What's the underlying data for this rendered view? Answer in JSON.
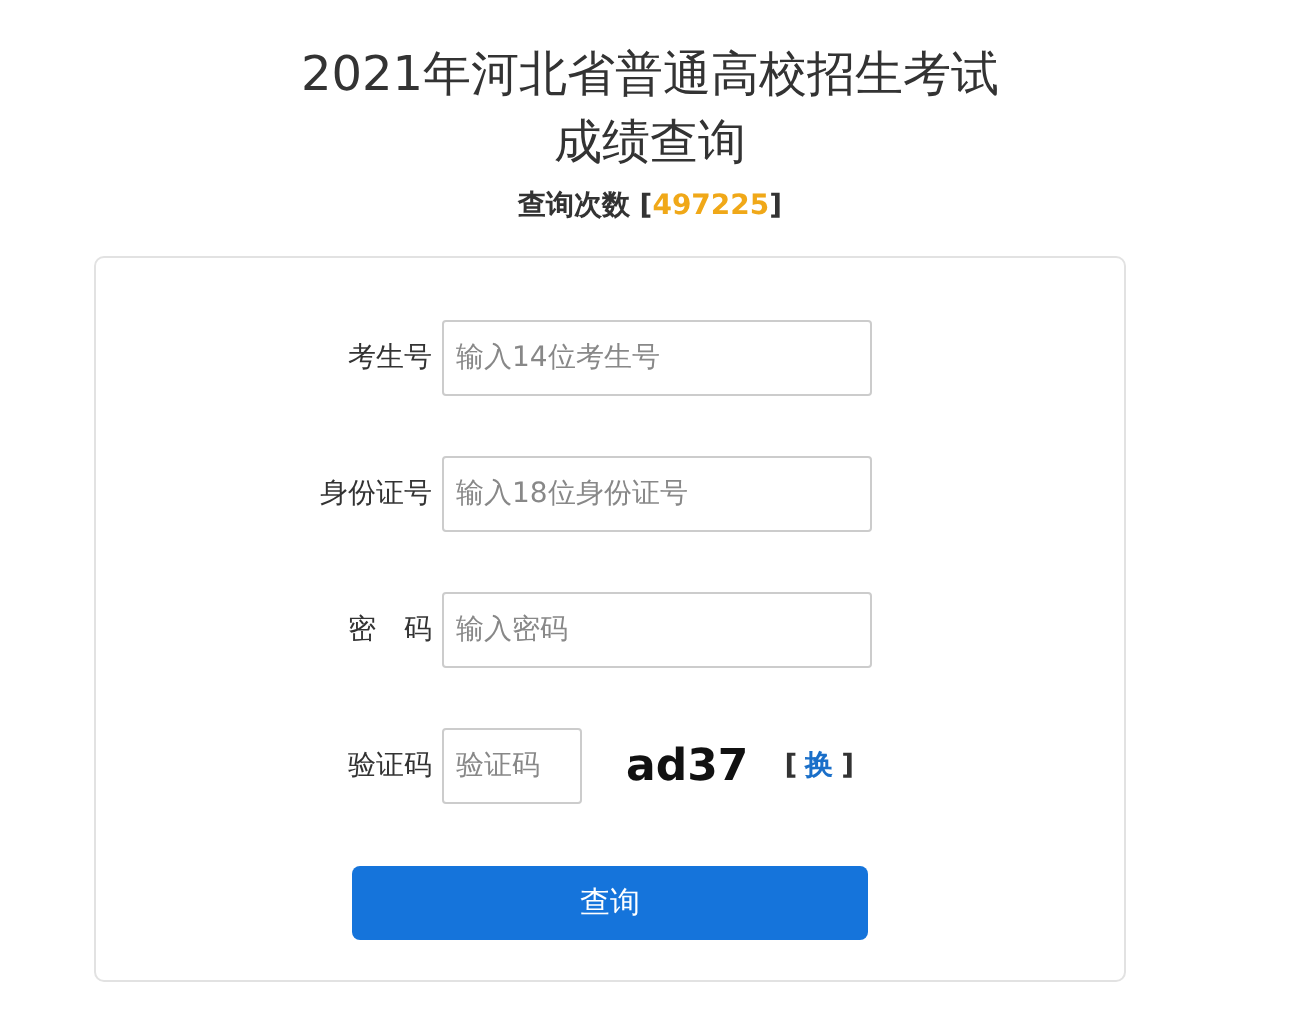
{
  "title": [
    "2021年河北省普通高校招生考试",
    "成绩查询"
  ],
  "counter": {
    "label": "查询次数 [",
    "count": "497225",
    "close": "]"
  },
  "fields": [
    {
      "label": "考生号",
      "placeholder": "输入14位考生号",
      "kind": "text"
    },
    {
      "label": "身份证号",
      "placeholder": "输入18位身份证号",
      "kind": "text"
    },
    {
      "label": "密　码",
      "placeholder": "输入密码",
      "kind": "password"
    },
    {
      "label": "验证码",
      "placeholder": "验证码",
      "kind": "captcha"
    }
  ],
  "captcha": {
    "code": "ad37",
    "open": "[",
    "refresh": "换",
    "close": "]"
  },
  "submit": "查询"
}
